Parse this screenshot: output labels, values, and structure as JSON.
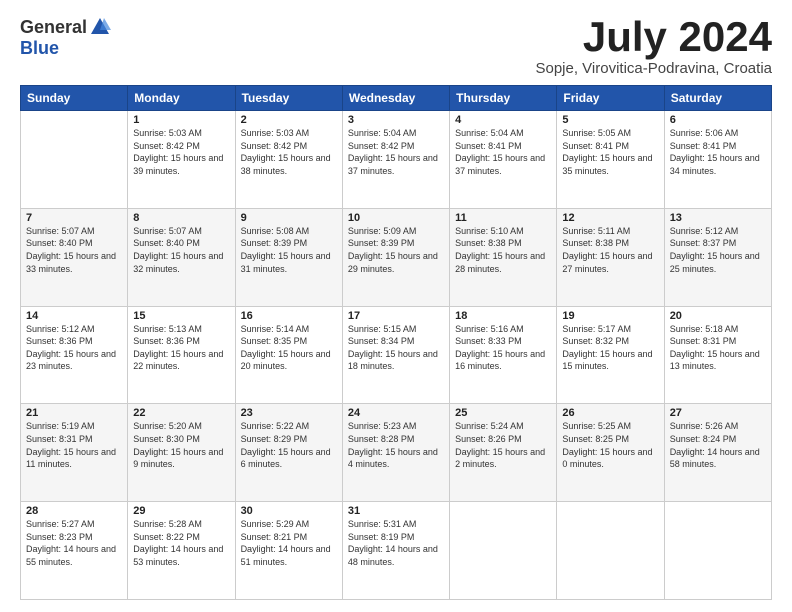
{
  "logo": {
    "general": "General",
    "blue": "Blue"
  },
  "title": "July 2024",
  "location": "Sopje, Virovitica-Podravina, Croatia",
  "days_of_week": [
    "Sunday",
    "Monday",
    "Tuesday",
    "Wednesday",
    "Thursday",
    "Friday",
    "Saturday"
  ],
  "weeks": [
    [
      {
        "day": "",
        "sunrise": "",
        "sunset": "",
        "daylight": ""
      },
      {
        "day": "1",
        "sunrise": "Sunrise: 5:03 AM",
        "sunset": "Sunset: 8:42 PM",
        "daylight": "Daylight: 15 hours and 39 minutes."
      },
      {
        "day": "2",
        "sunrise": "Sunrise: 5:03 AM",
        "sunset": "Sunset: 8:42 PM",
        "daylight": "Daylight: 15 hours and 38 minutes."
      },
      {
        "day": "3",
        "sunrise": "Sunrise: 5:04 AM",
        "sunset": "Sunset: 8:42 PM",
        "daylight": "Daylight: 15 hours and 37 minutes."
      },
      {
        "day": "4",
        "sunrise": "Sunrise: 5:04 AM",
        "sunset": "Sunset: 8:41 PM",
        "daylight": "Daylight: 15 hours and 37 minutes."
      },
      {
        "day": "5",
        "sunrise": "Sunrise: 5:05 AM",
        "sunset": "Sunset: 8:41 PM",
        "daylight": "Daylight: 15 hours and 35 minutes."
      },
      {
        "day": "6",
        "sunrise": "Sunrise: 5:06 AM",
        "sunset": "Sunset: 8:41 PM",
        "daylight": "Daylight: 15 hours and 34 minutes."
      }
    ],
    [
      {
        "day": "7",
        "sunrise": "Sunrise: 5:07 AM",
        "sunset": "Sunset: 8:40 PM",
        "daylight": "Daylight: 15 hours and 33 minutes."
      },
      {
        "day": "8",
        "sunrise": "Sunrise: 5:07 AM",
        "sunset": "Sunset: 8:40 PM",
        "daylight": "Daylight: 15 hours and 32 minutes."
      },
      {
        "day": "9",
        "sunrise": "Sunrise: 5:08 AM",
        "sunset": "Sunset: 8:39 PM",
        "daylight": "Daylight: 15 hours and 31 minutes."
      },
      {
        "day": "10",
        "sunrise": "Sunrise: 5:09 AM",
        "sunset": "Sunset: 8:39 PM",
        "daylight": "Daylight: 15 hours and 29 minutes."
      },
      {
        "day": "11",
        "sunrise": "Sunrise: 5:10 AM",
        "sunset": "Sunset: 8:38 PM",
        "daylight": "Daylight: 15 hours and 28 minutes."
      },
      {
        "day": "12",
        "sunrise": "Sunrise: 5:11 AM",
        "sunset": "Sunset: 8:38 PM",
        "daylight": "Daylight: 15 hours and 27 minutes."
      },
      {
        "day": "13",
        "sunrise": "Sunrise: 5:12 AM",
        "sunset": "Sunset: 8:37 PM",
        "daylight": "Daylight: 15 hours and 25 minutes."
      }
    ],
    [
      {
        "day": "14",
        "sunrise": "Sunrise: 5:12 AM",
        "sunset": "Sunset: 8:36 PM",
        "daylight": "Daylight: 15 hours and 23 minutes."
      },
      {
        "day": "15",
        "sunrise": "Sunrise: 5:13 AM",
        "sunset": "Sunset: 8:36 PM",
        "daylight": "Daylight: 15 hours and 22 minutes."
      },
      {
        "day": "16",
        "sunrise": "Sunrise: 5:14 AM",
        "sunset": "Sunset: 8:35 PM",
        "daylight": "Daylight: 15 hours and 20 minutes."
      },
      {
        "day": "17",
        "sunrise": "Sunrise: 5:15 AM",
        "sunset": "Sunset: 8:34 PM",
        "daylight": "Daylight: 15 hours and 18 minutes."
      },
      {
        "day": "18",
        "sunrise": "Sunrise: 5:16 AM",
        "sunset": "Sunset: 8:33 PM",
        "daylight": "Daylight: 15 hours and 16 minutes."
      },
      {
        "day": "19",
        "sunrise": "Sunrise: 5:17 AM",
        "sunset": "Sunset: 8:32 PM",
        "daylight": "Daylight: 15 hours and 15 minutes."
      },
      {
        "day": "20",
        "sunrise": "Sunrise: 5:18 AM",
        "sunset": "Sunset: 8:31 PM",
        "daylight": "Daylight: 15 hours and 13 minutes."
      }
    ],
    [
      {
        "day": "21",
        "sunrise": "Sunrise: 5:19 AM",
        "sunset": "Sunset: 8:31 PM",
        "daylight": "Daylight: 15 hours and 11 minutes."
      },
      {
        "day": "22",
        "sunrise": "Sunrise: 5:20 AM",
        "sunset": "Sunset: 8:30 PM",
        "daylight": "Daylight: 15 hours and 9 minutes."
      },
      {
        "day": "23",
        "sunrise": "Sunrise: 5:22 AM",
        "sunset": "Sunset: 8:29 PM",
        "daylight": "Daylight: 15 hours and 6 minutes."
      },
      {
        "day": "24",
        "sunrise": "Sunrise: 5:23 AM",
        "sunset": "Sunset: 8:28 PM",
        "daylight": "Daylight: 15 hours and 4 minutes."
      },
      {
        "day": "25",
        "sunrise": "Sunrise: 5:24 AM",
        "sunset": "Sunset: 8:26 PM",
        "daylight": "Daylight: 15 hours and 2 minutes."
      },
      {
        "day": "26",
        "sunrise": "Sunrise: 5:25 AM",
        "sunset": "Sunset: 8:25 PM",
        "daylight": "Daylight: 15 hours and 0 minutes."
      },
      {
        "day": "27",
        "sunrise": "Sunrise: 5:26 AM",
        "sunset": "Sunset: 8:24 PM",
        "daylight": "Daylight: 14 hours and 58 minutes."
      }
    ],
    [
      {
        "day": "28",
        "sunrise": "Sunrise: 5:27 AM",
        "sunset": "Sunset: 8:23 PM",
        "daylight": "Daylight: 14 hours and 55 minutes."
      },
      {
        "day": "29",
        "sunrise": "Sunrise: 5:28 AM",
        "sunset": "Sunset: 8:22 PM",
        "daylight": "Daylight: 14 hours and 53 minutes."
      },
      {
        "day": "30",
        "sunrise": "Sunrise: 5:29 AM",
        "sunset": "Sunset: 8:21 PM",
        "daylight": "Daylight: 14 hours and 51 minutes."
      },
      {
        "day": "31",
        "sunrise": "Sunrise: 5:31 AM",
        "sunset": "Sunset: 8:19 PM",
        "daylight": "Daylight: 14 hours and 48 minutes."
      },
      {
        "day": "",
        "sunrise": "",
        "sunset": "",
        "daylight": ""
      },
      {
        "day": "",
        "sunrise": "",
        "sunset": "",
        "daylight": ""
      },
      {
        "day": "",
        "sunrise": "",
        "sunset": "",
        "daylight": ""
      }
    ]
  ]
}
